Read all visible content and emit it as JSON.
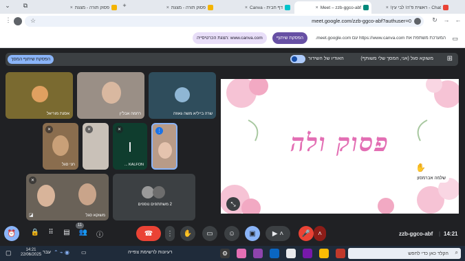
{
  "browser": {
    "tabs": [
      {
        "title": "Chat - ראשית פ\"ה! לבי עין!",
        "icon": "gmail-icon",
        "color": "#ea4335"
      },
      {
        "title": "Meet – zzb-ggco-abf",
        "icon": "meet-icon",
        "color": "#00897b",
        "active": true
      },
      {
        "title": "דף חבית - Canva",
        "icon": "canva-icon",
        "color": "#00c4cc"
      },
      {
        "title": "פסוק תורה - מצגת",
        "icon": "slides-icon",
        "color": "#f4b400"
      }
    ],
    "url": "meet.google.com/zzb-ggco-abf?authuser=0"
  },
  "share_banner": {
    "text": "המערכת משתפת את https://www.canva.com עם meet.google.com.",
    "stop_label": "הפסקת שיתוף",
    "switch_label": "הצגת הכרטיסייה: www.canva.com"
  },
  "meet_bar": {
    "presenting": "משוקא סגל (אני, המסך שלי משותף)",
    "audio_label": "האודיו של השידור",
    "stop_label": "הפסקת שיתוף המסך"
  },
  "tiles": [
    {
      "name": "אסנת מוריאל",
      "bg": "#7a6a30"
    },
    {
      "name": "רחמה אבל'ין",
      "bg": "#9a8f86"
    },
    {
      "name": "שרה בייליא משה גאוזה",
      "bg": "#2f4d5c"
    },
    {
      "name": "חני סגל",
      "bg": "#8a6d4e"
    },
    {
      "name": "",
      "bg": "#c9c1b8"
    },
    {
      "name": "KALFON ...",
      "bg": "#0f3d2e"
    },
    {
      "name": "",
      "bg": "#b89b88"
    },
    {
      "name": "משוקא סגל",
      "bg": "#6a6258"
    },
    {
      "name": "2 משתתפים נוספים",
      "bg": "#3c4043"
    }
  ],
  "presentation": {
    "title": "פסוק ולה",
    "speaker": "שלמה אברמסון"
  },
  "meeting_info": {
    "code": "zzb-ggco-abf",
    "time": "14:21",
    "participants_badge": "11"
  },
  "taskbar": {
    "search_placeholder": "הקלד כאן כדי לחפש",
    "notes": "רעיונות לרשימת צפייה",
    "time": "14:21",
    "date": "22/06/2025",
    "lang": "עבר"
  }
}
